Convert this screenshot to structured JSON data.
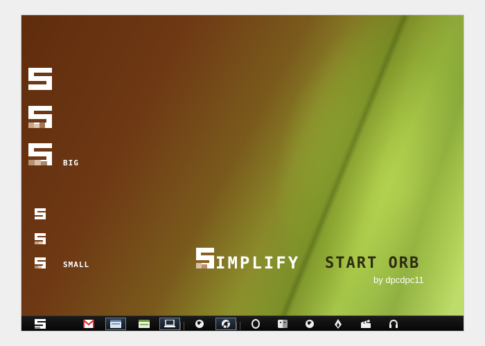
{
  "labels": {
    "big": "BIG",
    "small": "SMALL"
  },
  "title": {
    "simplify_rest": "IMPLIFY",
    "start_orb": "START ORB",
    "author": "by dpcdpc11"
  },
  "taskbar": {
    "items": [
      {
        "name": "start-orb-taskbar",
        "icon": "s-orb-icon"
      },
      {
        "name": "gmail-taskbar-button",
        "icon": "gmail-icon"
      },
      {
        "name": "window-taskbar-button",
        "icon": "window-icon"
      },
      {
        "name": "app-taskbar-button",
        "icon": "app-window-icon"
      },
      {
        "name": "computer-taskbar-button",
        "icon": "laptop-icon"
      },
      {
        "name": "firefox-taskbar-button",
        "icon": "firefox-icon"
      },
      {
        "name": "chrome-taskbar-button",
        "icon": "chrome-icon"
      },
      {
        "name": "opera-taskbar-button",
        "icon": "opera-icon"
      },
      {
        "name": "finder-taskbar-button",
        "icon": "finder-icon"
      },
      {
        "name": "firefox2-taskbar-button",
        "icon": "firefox-icon"
      },
      {
        "name": "vlc-taskbar-button",
        "icon": "flame-icon"
      },
      {
        "name": "clapper-taskbar-button",
        "icon": "clapperboard-icon"
      },
      {
        "name": "headphones-taskbar-button",
        "icon": "headphones-icon"
      }
    ]
  },
  "colors": {
    "accent_dark": "#2c2c10",
    "text_white": "#ffffff"
  }
}
